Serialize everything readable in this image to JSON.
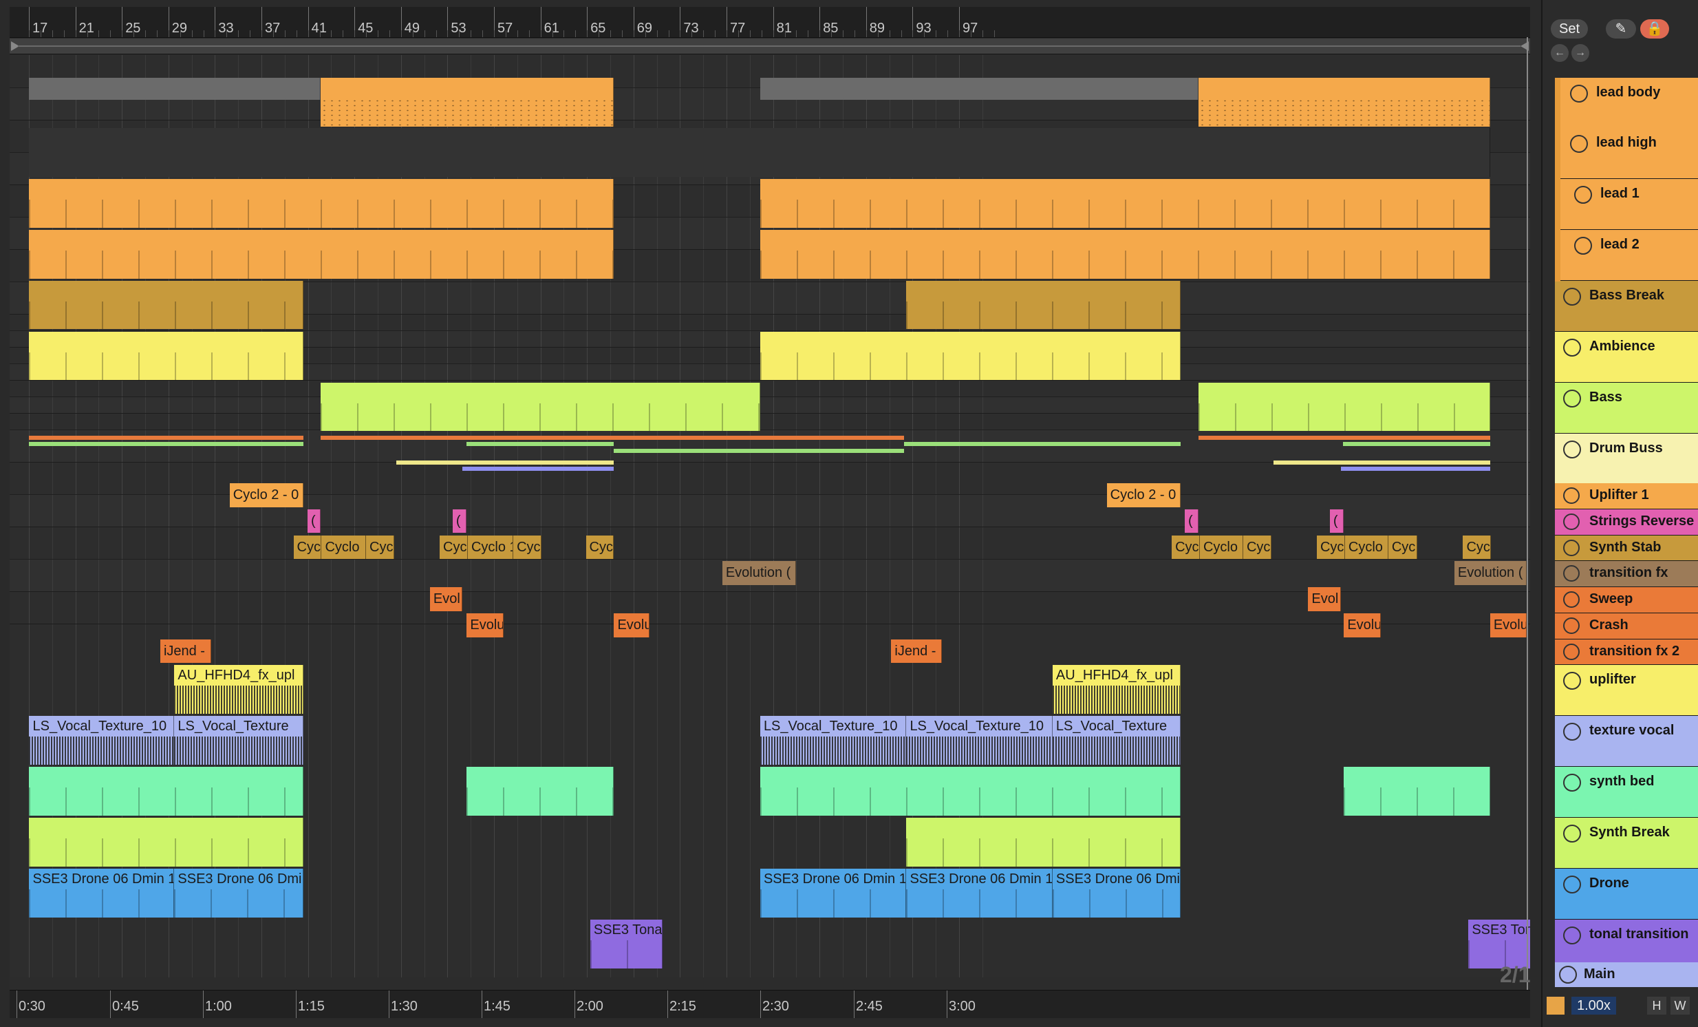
{
  "ruler": {
    "bars": [
      "17",
      "21",
      "25",
      "29",
      "33",
      "37",
      "41",
      "45",
      "49",
      "53",
      "57",
      "61",
      "65",
      "69",
      "73",
      "77",
      "81",
      "85",
      "89",
      "93",
      "97"
    ]
  },
  "time_ruler": {
    "labels": [
      "0:30",
      "0:45",
      "1:00",
      "1:15",
      "1:30",
      "1:45",
      "2:00",
      "2:15",
      "2:30",
      "2:45",
      "3:00"
    ]
  },
  "top_controls": {
    "set_label": "Set",
    "back_icon": "left-arrow-icon",
    "forward_icon": "right-arrow-icon",
    "pencil_icon": "draw-mode-icon",
    "lock_icon": "lock-icon"
  },
  "tracks": [
    {
      "name": "lead body",
      "color": "#f5a94b",
      "type": "group-fold"
    },
    {
      "name": "lead high",
      "color": "#f5a94b",
      "type": "group-folded"
    },
    {
      "name": "lead 1",
      "color": "#f5a94b",
      "type": "group-fold"
    },
    {
      "name": "lead 2",
      "color": "#f5a94b",
      "type": "group-fold"
    },
    {
      "name": "Bass Break",
      "color": "#c79a3c",
      "type": "group-fold"
    },
    {
      "name": "Ambience",
      "color": "#f7ee6a",
      "type": "group-fold"
    },
    {
      "name": "Bass",
      "color": "#cdf56a",
      "type": "group-fold"
    },
    {
      "name": "Drum Buss",
      "color": "#f7f2b0",
      "type": "group-folded"
    },
    {
      "name": "Uplifter 1",
      "color": "#f5a94b",
      "type": "play"
    },
    {
      "name": "Strings Reverse",
      "color": "#e260b0",
      "type": "play"
    },
    {
      "name": "Synth Stab",
      "color": "#c79a3c",
      "type": "play"
    },
    {
      "name": "transition fx",
      "color": "#9c7b58",
      "type": "play"
    },
    {
      "name": "Sweep",
      "color": "#ea7a38",
      "type": "play"
    },
    {
      "name": "Crash",
      "color": "#ea7a38",
      "type": "play"
    },
    {
      "name": "transition fx 2",
      "color": "#ea7a38",
      "type": "play"
    },
    {
      "name": "uplifter",
      "color": "#f7ee6a",
      "type": "group-fold"
    },
    {
      "name": "texture vocal",
      "color": "#a9b4f0",
      "type": "group-fold"
    },
    {
      "name": "synth bed",
      "color": "#7bf5b0",
      "type": "group-fold"
    },
    {
      "name": "Synth Break",
      "color": "#cdf56a",
      "type": "group-fold"
    },
    {
      "name": "Drone",
      "color": "#4fa6e8",
      "type": "group-fold"
    },
    {
      "name": "tonal transition",
      "color": "#8f6be0",
      "type": "group-fold"
    }
  ],
  "clip_labels": {
    "cyclo20": "Cyclo 2 - 0",
    "cyc": "Cyc",
    "cyclo": "Cyclo",
    "cyclo1": "Cyclo 1",
    "paren": "(",
    "evolution": "Evolution (",
    "evol": "Evol",
    "evolu": "Evolu",
    "ijend": "iJend -",
    "au": "AU_HFHD4_fx_upl",
    "vocal10": "LS_Vocal_Texture_10",
    "vocal": "LS_Vocal_Texture",
    "drone1": "SSE3 Drone 06 Dmin 1",
    "drone2": "SSE3 Drone 06 Dmi",
    "tona": "SSE3 Tona"
  },
  "main_track": {
    "name": "Main",
    "color": "#a9b4f0"
  },
  "status": {
    "zoom": "1.00x",
    "h_label": "H",
    "w_label": "W",
    "signature": "2/1"
  },
  "colors": {
    "orange": "#f5a94b",
    "gold": "#c79a3c",
    "yellow": "#f7ee6a",
    "lime": "#cdf56a",
    "mint": "#7bf5b0",
    "periwinkle": "#a9b4f0",
    "blue": "#4fa6e8",
    "purple": "#8f6be0",
    "pink": "#e260b0",
    "brown": "#9c7b58",
    "darkorange": "#ea7a38"
  }
}
